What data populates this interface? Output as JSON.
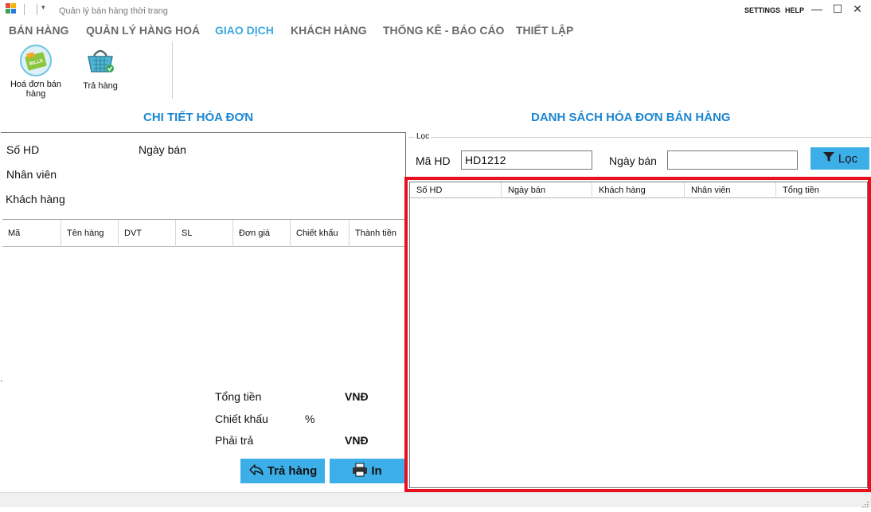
{
  "window": {
    "title": "Quản lý bán hàng thời trang",
    "settings_link": "SETTINGS",
    "help_link": "HELP",
    "minimize": "—",
    "maximize": "☐",
    "close": "✕"
  },
  "ribbon_tabs": [
    {
      "label": "BÁN HÀNG"
    },
    {
      "label": "QUẢN LÝ HÀNG HOÁ"
    },
    {
      "label": "GIAO DỊCH"
    },
    {
      "label": "KHÁCH HÀNG"
    },
    {
      "label": "THỐNG KÊ - BÁO CÁO"
    },
    {
      "label": "THIẾT LẬP"
    }
  ],
  "ribbon_buttons": [
    {
      "label": "Hoá đơn bán hàng",
      "icon": "bills-icon"
    },
    {
      "label": "Trả hàng",
      "icon": "basket-icon"
    }
  ],
  "invoice_detail": {
    "title": "CHI TIẾT HÓA ĐƠN",
    "so_hd_label": "Số HD",
    "ngay_ban_label": "Ngày bán",
    "nhan_vien_label": "Nhân viên",
    "khach_hang_label": "Khách hàng",
    "columns": [
      "Mã",
      "Tên hàng",
      "DVT",
      "SL",
      "Đơn giá",
      "Chiết khấu",
      "Thành tiền"
    ],
    "rows": []
  },
  "totals": {
    "tong_tien_label": "Tổng tiền",
    "tong_tien_unit": "VNĐ",
    "chiet_khau_label": "Chiết khấu",
    "chiet_khau_unit": "%",
    "phai_tra_label": "Phải trả",
    "phai_tra_unit": "VNĐ"
  },
  "actions": {
    "return_label": "Trả hàng",
    "print_label": "In"
  },
  "invoice_list": {
    "title": "DANH SÁCH HÓA ĐƠN BÁN HÀNG",
    "filter_legend": "Lọc",
    "ma_hd_label": "Mã HD",
    "ma_hd_value": "HD1212",
    "ngay_ban_label": "Ngày bán",
    "ngay_ban_value": "",
    "filter_button": "Lọc",
    "columns": [
      "Số HD",
      "Ngày bán",
      "Khách hàng",
      "Nhân viên",
      "Tổng tiền"
    ],
    "rows": []
  },
  "colors": {
    "accent": "#3da8e0",
    "button": "#3dafe8",
    "highlight": "#e8101e",
    "section_title": "#1c86d1"
  }
}
